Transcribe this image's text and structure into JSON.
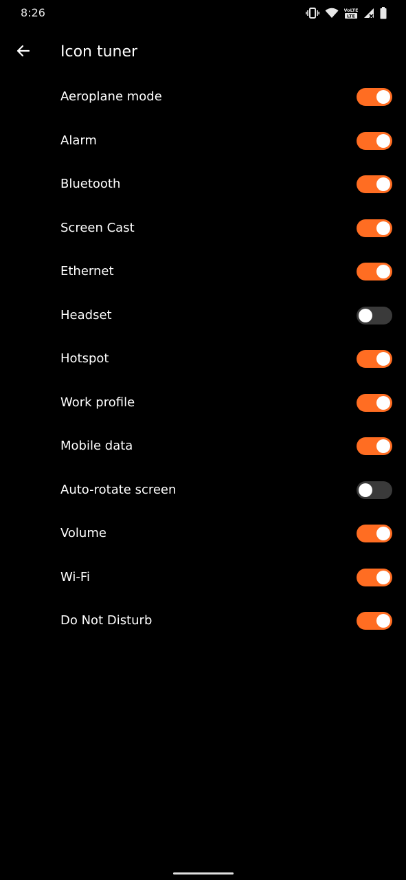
{
  "status_bar": {
    "time": "8:26",
    "icons": [
      "vibrate-icon",
      "wifi-icon",
      "volte-lte-icon",
      "mobile-signal-icon",
      "battery-icon"
    ],
    "volte_text": "VoLTE",
    "lte_text": "LTE"
  },
  "header": {
    "title": "Icon tuner",
    "back_icon": "arrow-back-icon"
  },
  "colors": {
    "background": "#000000",
    "accent": "#ff6d22",
    "toggle_off_track": "#3a3a3a",
    "text": "#ffffff"
  },
  "items": [
    {
      "label": "Aeroplane mode",
      "on": true
    },
    {
      "label": "Alarm",
      "on": true
    },
    {
      "label": "Bluetooth",
      "on": true
    },
    {
      "label": "Screen Cast",
      "on": true
    },
    {
      "label": "Ethernet",
      "on": true
    },
    {
      "label": "Headset",
      "on": false
    },
    {
      "label": "Hotspot",
      "on": true
    },
    {
      "label": "Work profile",
      "on": true
    },
    {
      "label": "Mobile data",
      "on": true
    },
    {
      "label": "Auto-rotate screen",
      "on": false
    },
    {
      "label": "Volume",
      "on": true
    },
    {
      "label": "Wi-Fi",
      "on": true
    },
    {
      "label": "Do Not Disturb",
      "on": true
    }
  ]
}
